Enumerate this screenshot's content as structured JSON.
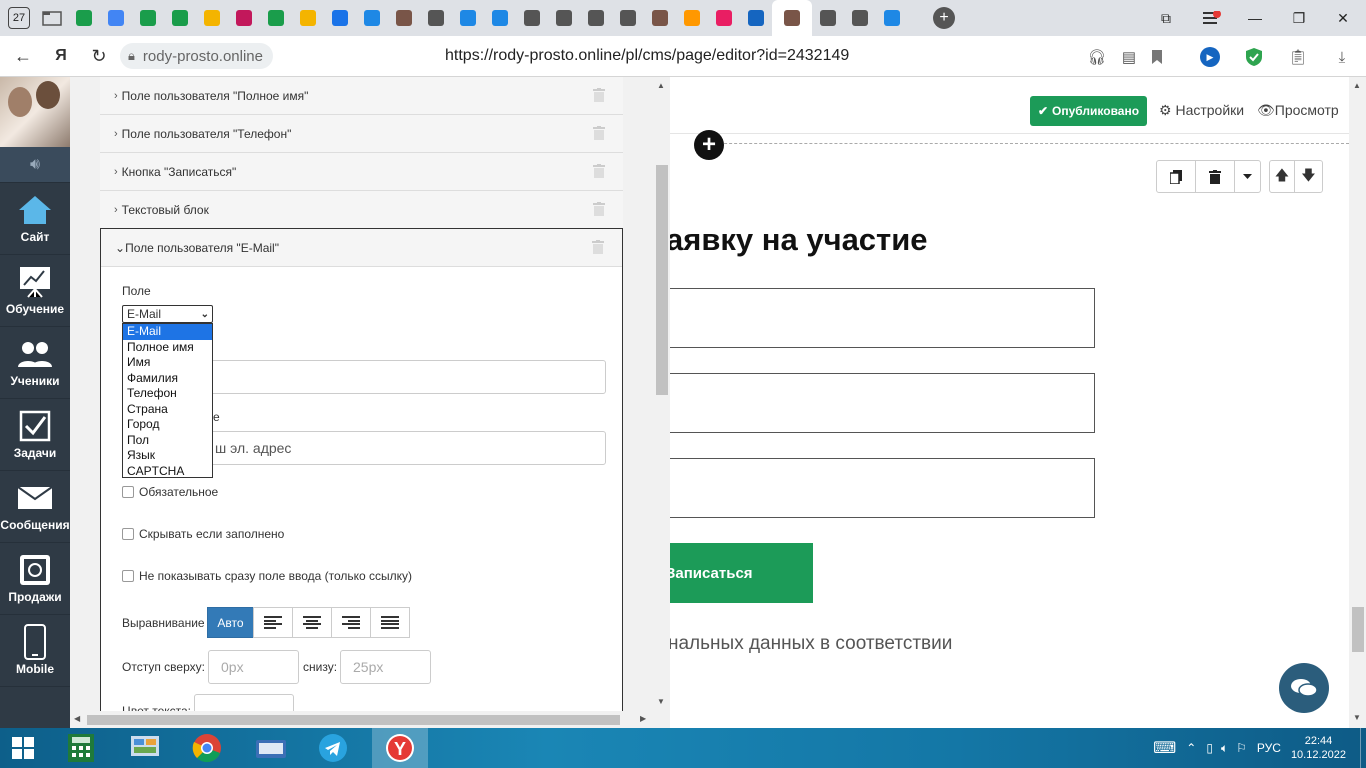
{
  "browser": {
    "tab_count": "27",
    "domain": "rody-prosto.online",
    "url": "https://rody-prosto.online/pl/cms/page/editor?id=2432149",
    "tab_colors": [
      "#1a9d4b",
      "#4285f4",
      "#1a9d4b",
      "#1a9d4b",
      "#f4b400",
      "#c2185b",
      "#1a9d4b",
      "#f4b400",
      "#1a73e8",
      "#1e88e5",
      "#795548",
      "#555555",
      "#1e88e5",
      "#1e88e5",
      "#555555",
      "#555555",
      "#555555",
      "#555555",
      "#795548",
      "#ff9800",
      "#e91e63",
      "#1565c0",
      "#795548",
      "#555555",
      "#555555",
      "#1e88e5"
    ]
  },
  "app_sidebar": {
    "items": [
      {
        "label": "Сайт",
        "icon": "house-icon"
      },
      {
        "label": "Обучение",
        "icon": "presentation-icon"
      },
      {
        "label": "Ученики",
        "icon": "users-icon"
      },
      {
        "label": "Задачи",
        "icon": "checkbox-icon"
      },
      {
        "label": "Сообщения",
        "icon": "envelope-icon"
      },
      {
        "label": "Продажи",
        "icon": "safe-icon"
      },
      {
        "label": "Mobile",
        "icon": "phone-icon"
      }
    ]
  },
  "editor": {
    "rows": [
      {
        "label": "Поле пользователя \"Полное имя\""
      },
      {
        "label": "Поле пользователя \"Телефон\""
      },
      {
        "label": "Кнопка \"Записаться\""
      },
      {
        "label": "Текстовый блок"
      }
    ],
    "open_block": {
      "title": "Поле пользователя \"E-Mail\"",
      "field_label": "Поле",
      "field_value": "E-Mail",
      "options": [
        "E-Mail",
        "Полное имя",
        "Имя",
        "Фамилия",
        "Телефон",
        "Страна",
        "Город",
        "Пол",
        "Язык",
        "CAPTCHA"
      ],
      "placeholder_label_tail": "е",
      "placeholder_value": "Ваш эл. адрес",
      "placeholder_visible": "ш эл. адрес",
      "required_label": "Обязательное",
      "hide_filled_label": "Скрывать если заполнено",
      "no_input_label": "Не показывать сразу поле ввода (только ссылку)",
      "align_label": "Выравнивание",
      "align_auto": "Авто",
      "indent_top_label": "Отступ сверху:",
      "indent_top_placeholder": "0px",
      "indent_bottom_label": "снизу:",
      "indent_bottom_placeholder": "25px",
      "text_color_label": "Цвет текста:"
    }
  },
  "preview": {
    "published": "Опубликовано",
    "settings": "Настройки",
    "view": "Просмотр",
    "heading_visible": "аявку на участие",
    "button_visible": "Записаться",
    "consent_visible": "нальных данных в соответствии"
  },
  "taskbar": {
    "lang": "РУС",
    "time": "22:44",
    "date": "10.12.2022"
  }
}
